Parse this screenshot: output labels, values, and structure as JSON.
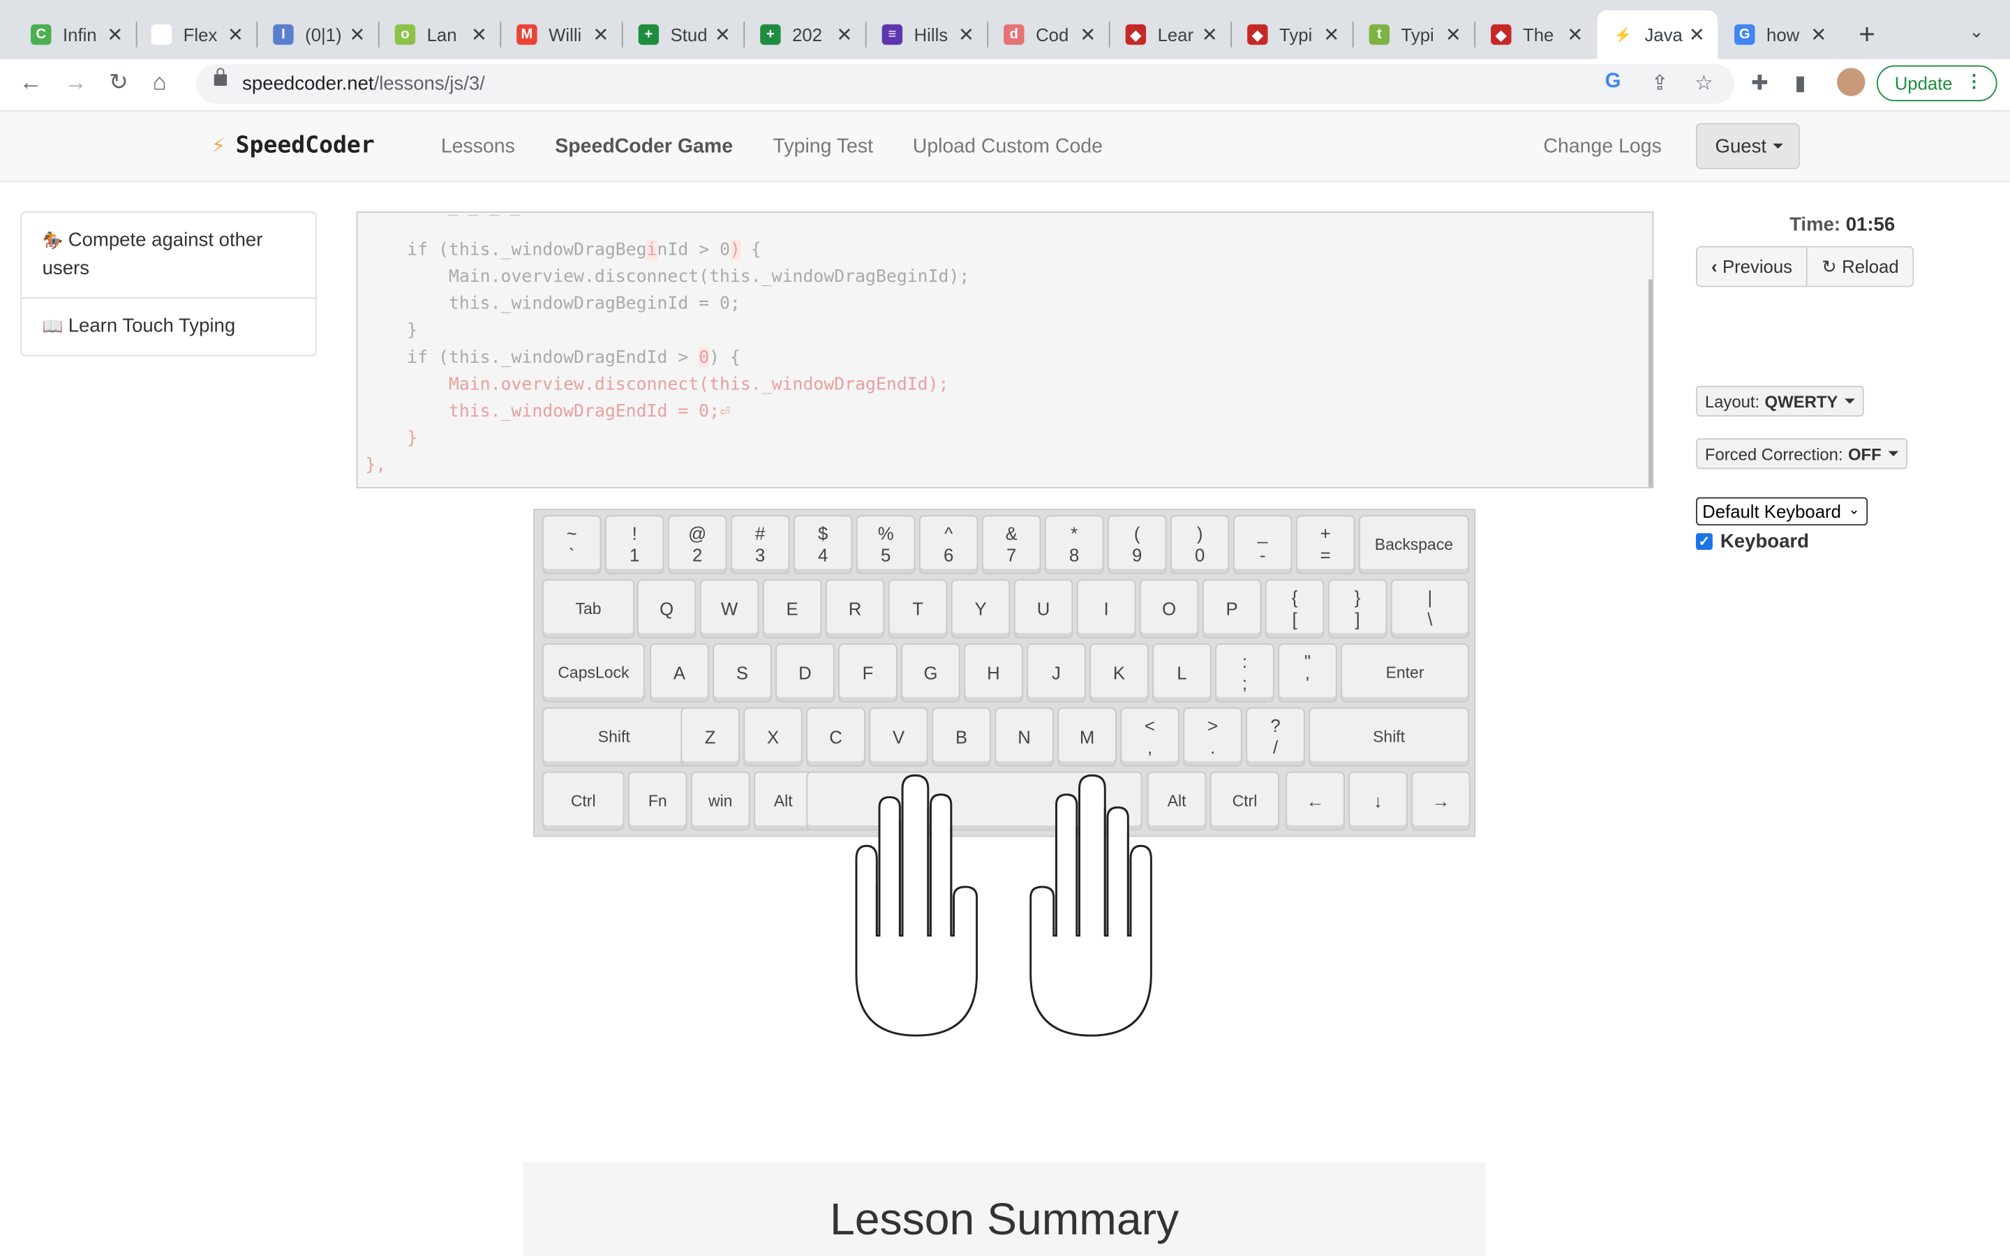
{
  "browser": {
    "tabs": [
      {
        "title": "Infin",
        "color": "#4caf50",
        "glyph": "C"
      },
      {
        "title": "Flex",
        "color": "#ffffff",
        "glyph": ""
      },
      {
        "title": "(0|1)",
        "color": "#5b7fcf",
        "glyph": "I"
      },
      {
        "title": "Lan",
        "color": "#8bc34a",
        "glyph": "o"
      },
      {
        "title": "Willi",
        "color": "#ea4335",
        "glyph": "M"
      },
      {
        "title": "Stud",
        "color": "#1e8e3e",
        "glyph": "+"
      },
      {
        "title": "202",
        "color": "#1e8e3e",
        "glyph": "+"
      },
      {
        "title": "Hills",
        "color": "#5e35b1",
        "glyph": "≡"
      },
      {
        "title": "Cod",
        "color": "#e57373",
        "glyph": "d"
      },
      {
        "title": "Lear",
        "color": "#c62828",
        "glyph": "◆"
      },
      {
        "title": "Typi",
        "color": "#c62828",
        "glyph": "◆"
      },
      {
        "title": "Typi",
        "color": "#7cb342",
        "glyph": "t"
      },
      {
        "title": "The",
        "color": "#c62828",
        "glyph": "◆"
      },
      {
        "title": "Java",
        "color": "#ffffff",
        "glyph": "⚡",
        "active": true
      },
      {
        "title": "how",
        "color": "#4285f4",
        "glyph": "G"
      }
    ],
    "url_domain": "speedcoder.net",
    "url_path": "/lessons/js/3/",
    "update_label": "Update"
  },
  "site": {
    "brand": "SpeedCoder",
    "nav": {
      "lessons": "Lessons",
      "game": "SpeedCoder Game",
      "typing_test": "Typing Test",
      "upload": "Upload Custom Code",
      "change_logs": "Change Logs",
      "guest": "Guest"
    }
  },
  "sidebar": {
    "items": [
      {
        "icon": "🏇",
        "label": "Compete against other users"
      },
      {
        "icon": "📖",
        "label": "Learn Touch Typing"
      }
    ]
  },
  "code": {
    "lines": [
      "    if (this._windowDragBeginId > 0) {",
      "        Main.overview.disconnect(this._windowDragBeginId);",
      "        this._windowDragBeginId = 0;",
      "    }",
      "    if (this._windowDragEndId > 0) {",
      "        Main.overview.disconnect(this._windowDragEndId);",
      "        this._windowDragEndId = 0;⏎",
      "    }",
      "},"
    ]
  },
  "controls": {
    "time_label": "Time:",
    "time_value": "01:56",
    "previous": "Previous",
    "reload": "Reload",
    "layout_label": "Layout:",
    "layout_value": "QWERTY",
    "forced_label": "Forced Correction:",
    "forced_value": "OFF",
    "keyboard_select": "Default Keyboard",
    "keyboard_checkbox": "Keyboard",
    "keyboard_checked": true
  },
  "keyboard": {
    "rows": [
      [
        [
          "~",
          "`"
        ],
        [
          "!",
          "1"
        ],
        [
          "@",
          "2"
        ],
        [
          "#",
          "3"
        ],
        [
          "$",
          "4"
        ],
        [
          "%",
          "5"
        ],
        [
          "^",
          "6"
        ],
        [
          "&",
          "7"
        ],
        [
          "*",
          "8"
        ],
        [
          "(",
          "9"
        ],
        [
          ")",
          "0"
        ],
        [
          "_",
          "-"
        ],
        [
          "+",
          "="
        ],
        [
          "Backspace"
        ]
      ],
      [
        [
          "Tab"
        ],
        [
          "Q"
        ],
        [
          "W"
        ],
        [
          "E"
        ],
        [
          "R"
        ],
        [
          "T"
        ],
        [
          "Y"
        ],
        [
          "U"
        ],
        [
          "I"
        ],
        [
          "O"
        ],
        [
          "P"
        ],
        [
          "{",
          "["
        ],
        [
          "}",
          "]"
        ],
        [
          "|",
          "\\"
        ]
      ],
      [
        [
          "CapsLock"
        ],
        [
          "A"
        ],
        [
          "S"
        ],
        [
          "D"
        ],
        [
          "F"
        ],
        [
          "G"
        ],
        [
          "H"
        ],
        [
          "J"
        ],
        [
          "K"
        ],
        [
          "L"
        ],
        [
          ":",
          ";"
        ],
        [
          "\"",
          "'"
        ],
        [
          "Enter"
        ]
      ],
      [
        [
          "Shift"
        ],
        [
          "Z"
        ],
        [
          "X"
        ],
        [
          "C"
        ],
        [
          "V"
        ],
        [
          "B"
        ],
        [
          "N"
        ],
        [
          "M"
        ],
        [
          "<",
          ","
        ],
        [
          ">",
          "."
        ],
        [
          "?",
          "/"
        ],
        [
          "Shift"
        ]
      ],
      [
        [
          "Ctrl"
        ],
        [
          "Fn"
        ],
        [
          "win"
        ],
        [
          "Alt"
        ],
        [
          ""
        ],
        [
          "Alt"
        ],
        [
          "Ctrl"
        ],
        [
          "←"
        ],
        [
          "↓"
        ],
        [
          "→"
        ]
      ]
    ]
  },
  "summary": {
    "title": "Lesson Summary"
  }
}
